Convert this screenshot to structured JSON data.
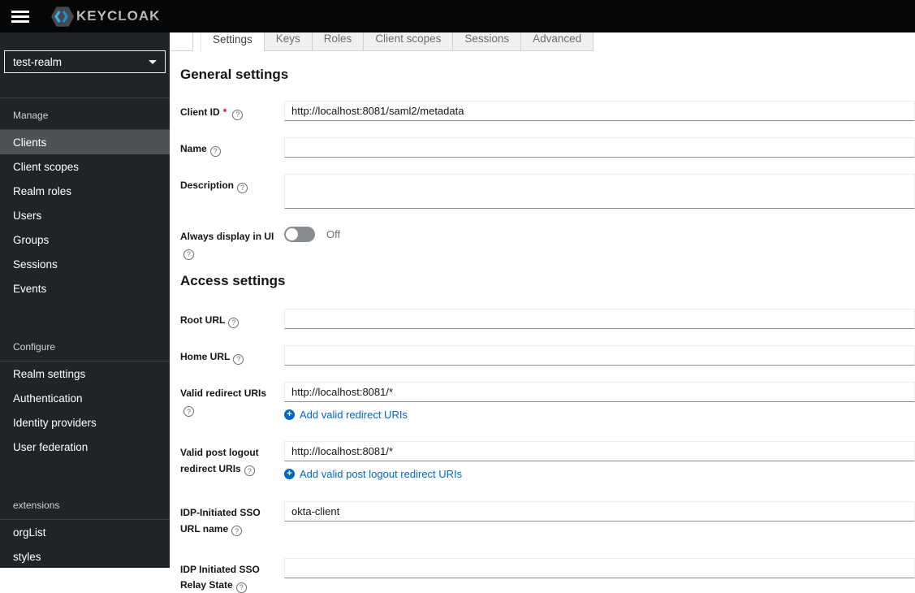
{
  "topbar": {
    "brand_text": "KEYCLOAK"
  },
  "sidebar": {
    "realm_selector": {
      "value": "test-realm"
    },
    "groups": [
      {
        "title": "Manage",
        "items": [
          {
            "label": "Clients",
            "active": true
          },
          {
            "label": "Client scopes",
            "active": false
          },
          {
            "label": "Realm roles",
            "active": false
          },
          {
            "label": "Users",
            "active": false
          },
          {
            "label": "Groups",
            "active": false
          },
          {
            "label": "Sessions",
            "active": false
          },
          {
            "label": "Events",
            "active": false
          }
        ]
      },
      {
        "title": "Configure",
        "items": [
          {
            "label": "Realm settings",
            "active": false
          },
          {
            "label": "Authentication",
            "active": false
          },
          {
            "label": "Identity providers",
            "active": false
          },
          {
            "label": "User federation",
            "active": false
          }
        ]
      },
      {
        "title": "extensions",
        "items": [
          {
            "label": "orgList",
            "active": false
          },
          {
            "label": "styles",
            "active": false
          }
        ]
      }
    ]
  },
  "tabs": {
    "active": "Settings",
    "items": [
      {
        "label": "Settings"
      },
      {
        "label": "Keys"
      },
      {
        "label": "Roles"
      },
      {
        "label": "Client scopes"
      },
      {
        "label": "Sessions"
      },
      {
        "label": "Advanced"
      }
    ]
  },
  "form": {
    "general": {
      "heading": "General settings",
      "client_id": {
        "label": "Client ID",
        "required_mark": "*",
        "value": "http://localhost:8081/saml2/metadata"
      },
      "name": {
        "label": "Name",
        "value": ""
      },
      "description": {
        "label": "Description",
        "value": ""
      },
      "always_display": {
        "label": "Always display in UI",
        "state": "Off"
      }
    },
    "access": {
      "heading": "Access settings",
      "root_url": {
        "label": "Root URL",
        "value": ""
      },
      "home_url": {
        "label": "Home URL",
        "value": ""
      },
      "valid_redirect_uris": {
        "label": "Valid redirect URIs",
        "value": "http://localhost:8081/*",
        "add_label": "Add valid redirect URIs"
      },
      "valid_post_logout_redirect_uris": {
        "label": "Valid post logout redirect URIs",
        "value": "http://localhost:8081/*",
        "add_label": "Add valid post logout redirect URIs"
      },
      "idp_initiated_sso_url_name": {
        "label": "IDP-Initiated SSO URL name",
        "value": "okta-client"
      },
      "idp_initiated_sso_relay_state": {
        "label": "IDP Initiated SSO Relay State",
        "value": ""
      }
    }
  },
  "colors": {
    "topbar_bg": "#060606",
    "sidebar_bg": "#212427",
    "nav_active_bg": "#4f5255",
    "link_blue": "#0066cc",
    "required_red": "#c9190b",
    "keycloak_blue": "#35b5e5"
  }
}
